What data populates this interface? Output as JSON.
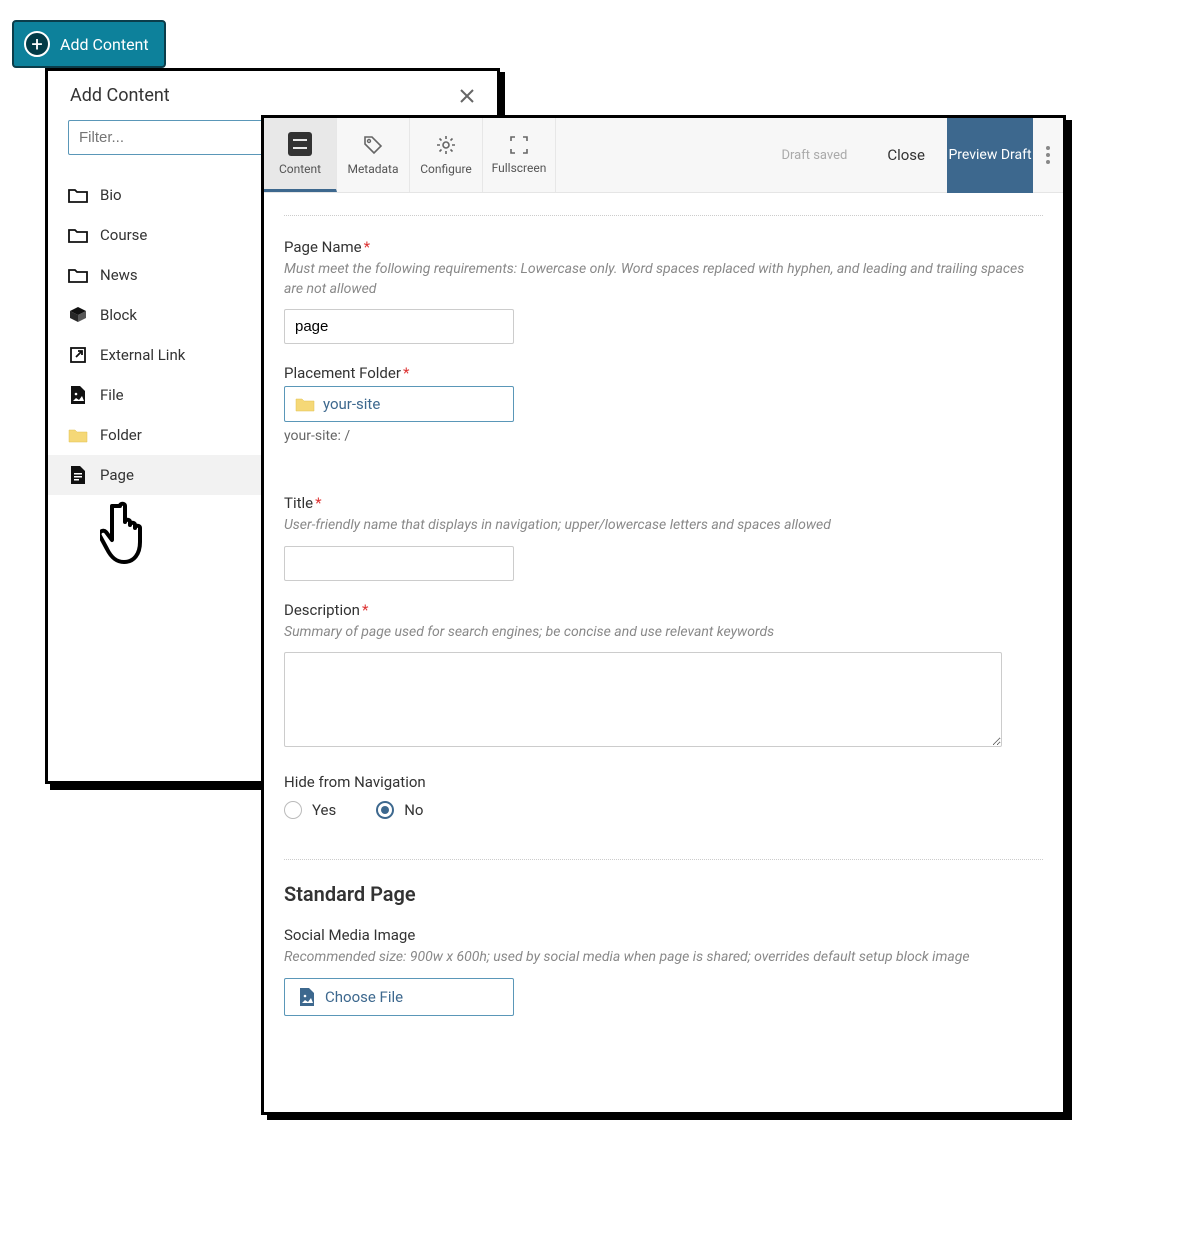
{
  "addButton": {
    "label": "Add Content"
  },
  "panel": {
    "title": "Add Content",
    "filterPlaceholder": "Filter...",
    "items": [
      {
        "label": "Bio"
      },
      {
        "label": "Course"
      },
      {
        "label": "News"
      },
      {
        "label": "Block"
      },
      {
        "label": "External Link"
      },
      {
        "label": "File"
      },
      {
        "label": "Folder"
      },
      {
        "label": "Page"
      }
    ]
  },
  "editor": {
    "toolbar": {
      "tabs": {
        "content": "Content",
        "metadata": "Metadata",
        "configure": "Configure",
        "fullscreen": "Fullscreen"
      },
      "draftSaved": "Draft saved",
      "close": "Close",
      "preview": "Preview Draft"
    },
    "pageName": {
      "label": "Page Name",
      "help": "Must meet the following requirements: Lowercase only. Word spaces replaced with hyphen, and leading and trailing spaces are not allowed",
      "value": "page"
    },
    "placementFolder": {
      "label": "Placement Folder",
      "value": "your-site",
      "breadcrumb": "your-site: /"
    },
    "title": {
      "label": "Title",
      "help": "User-friendly name that displays in navigation; upper/lowercase letters and spaces allowed",
      "value": ""
    },
    "description": {
      "label": "Description",
      "help": "Summary of page used for search engines; be concise and use relevant keywords",
      "value": ""
    },
    "hideFromNav": {
      "label": "Hide from Navigation",
      "yes": "Yes",
      "no": "No",
      "selected": "No"
    },
    "standardPage": {
      "heading": "Standard Page",
      "socialLabel": "Social Media Image",
      "socialHelp": "Recommended size: 900w x 600h; used by social media when page is shared; overrides default setup block image",
      "chooseFile": "Choose File"
    }
  }
}
